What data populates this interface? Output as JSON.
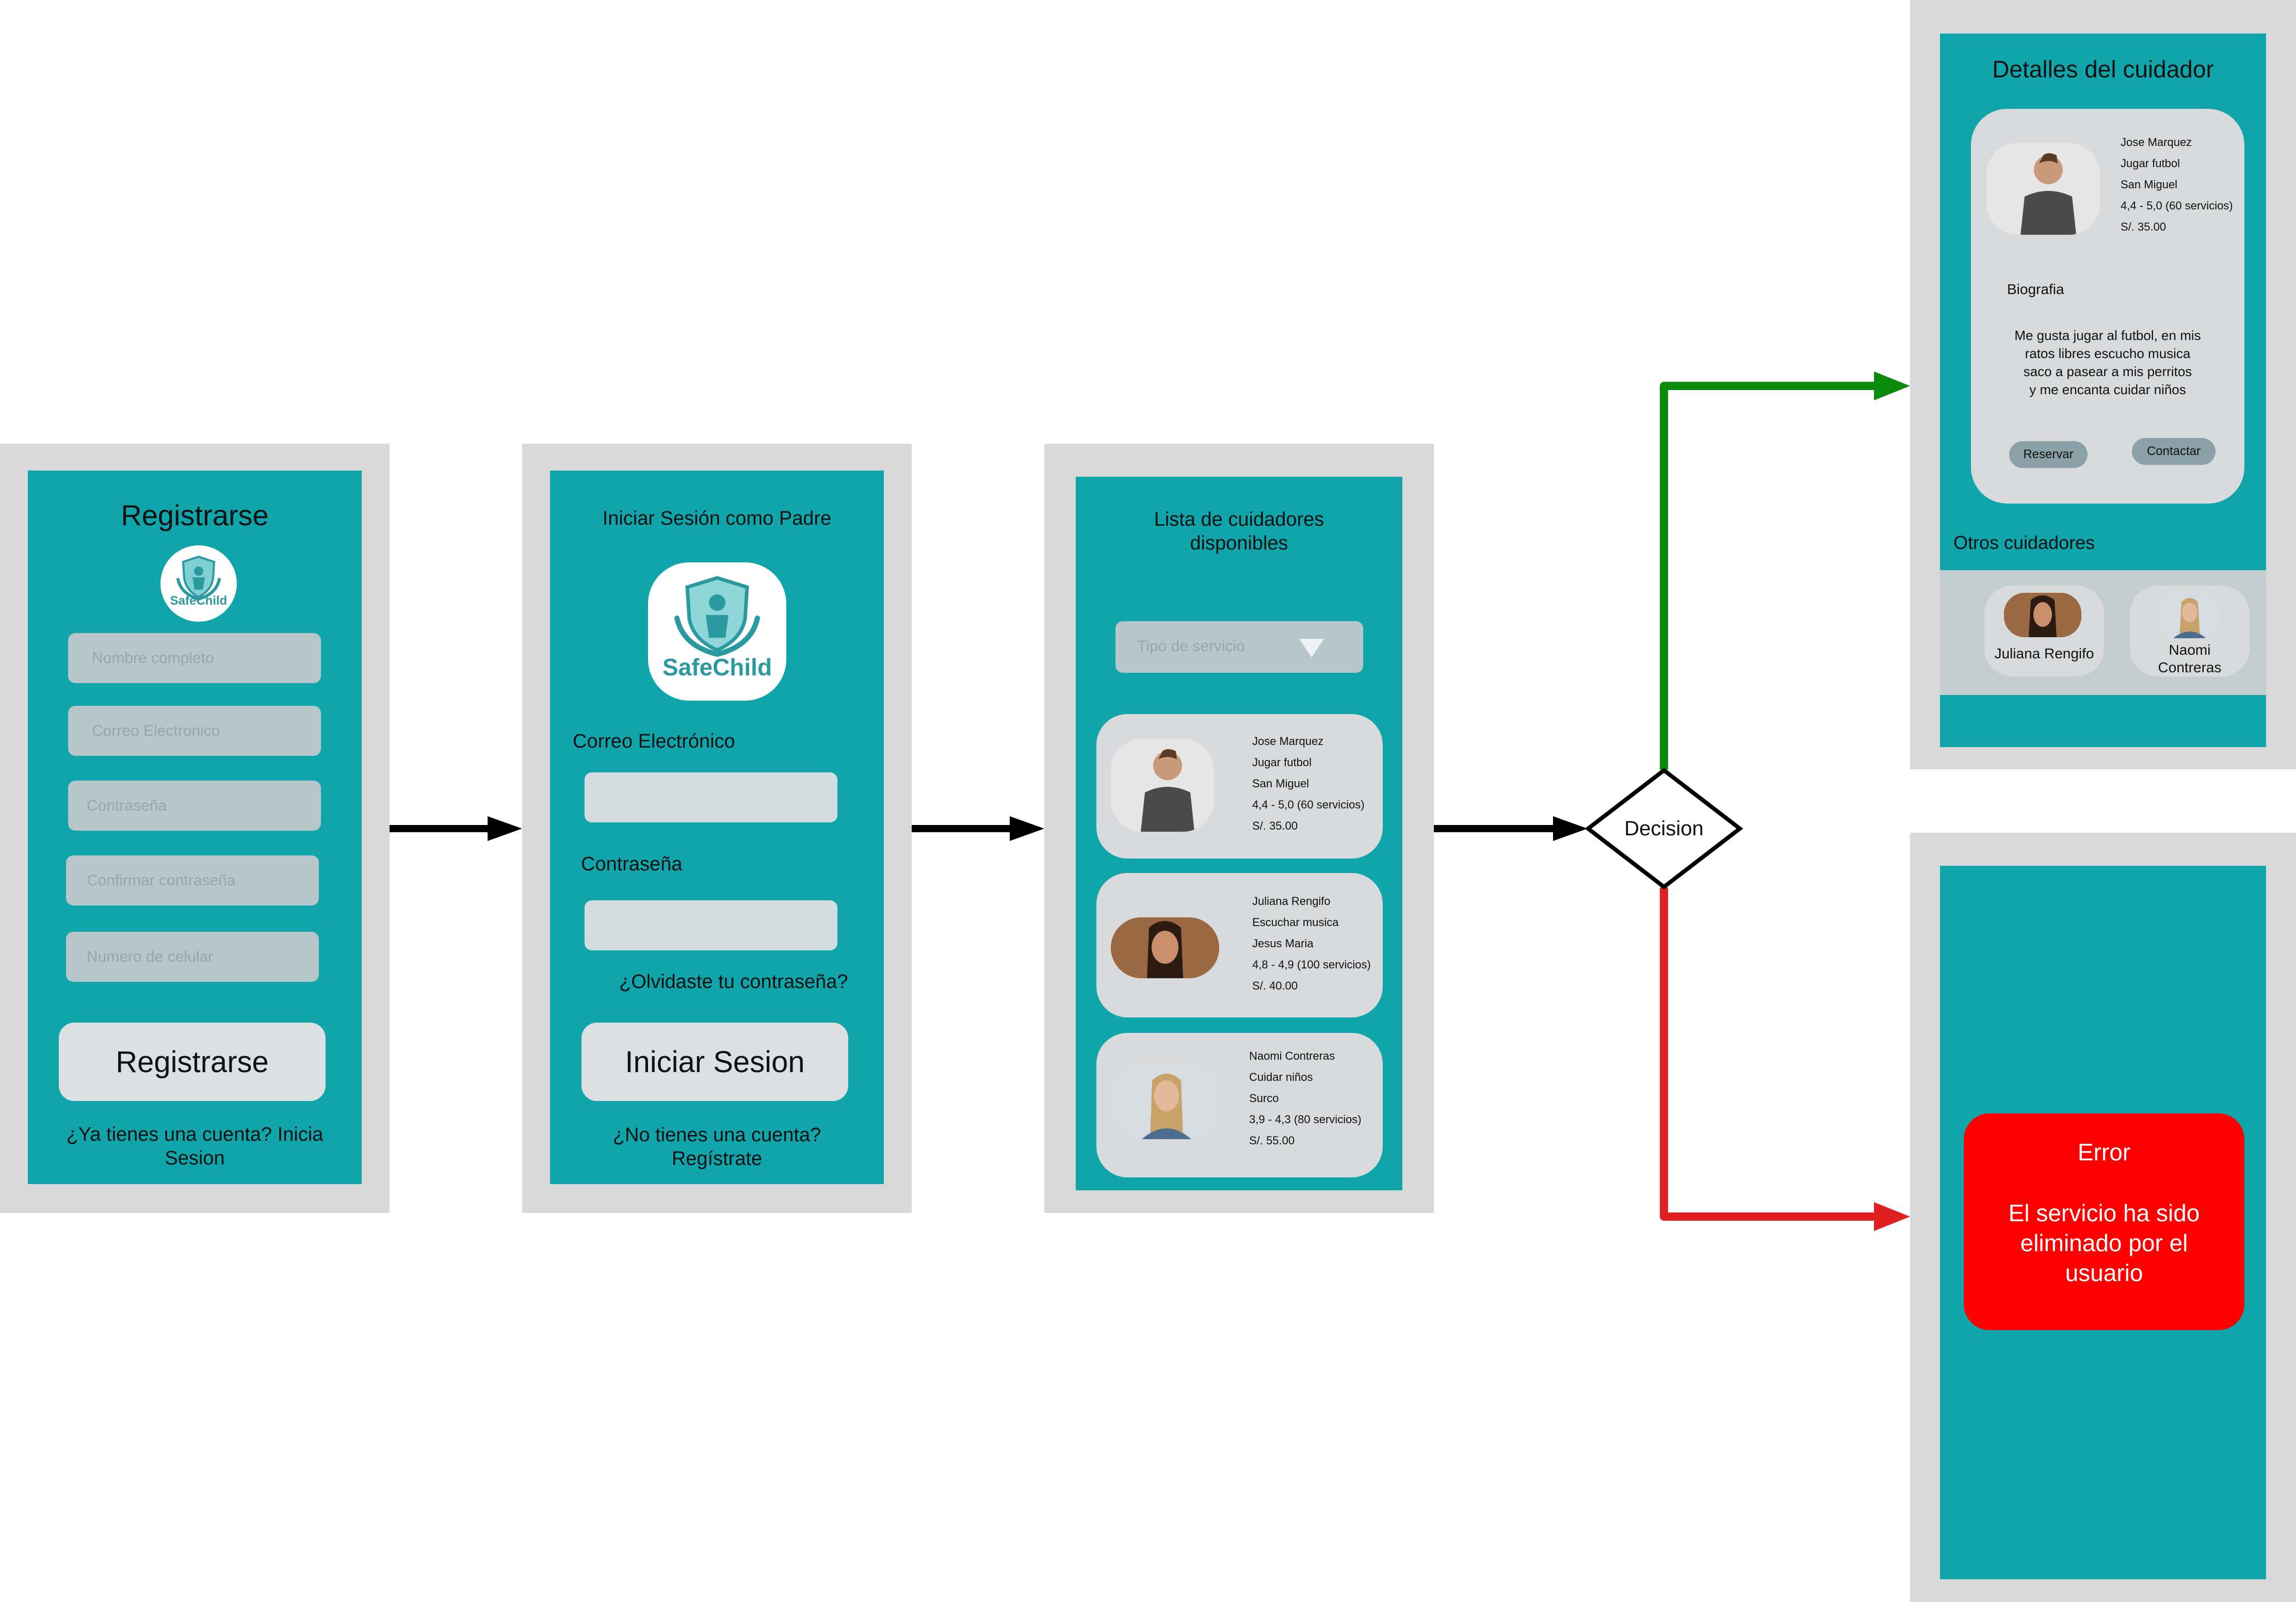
{
  "register": {
    "title": "Registrarse",
    "logo_text": "SafeChild",
    "fields": [
      "Nombre completo",
      "Correo Electronico",
      "Contraseña",
      "Confirmar contraseña",
      "Numero de celular"
    ],
    "button": "Registrarse",
    "footer_line1": "¿Ya tienes una cuenta? Inicia",
    "footer_line2": "Sesion"
  },
  "login": {
    "title": "Iniciar Sesión como Padre",
    "logo_text": "SafeChild",
    "email_label": "Correo Electrónico",
    "password_label": "Contraseña",
    "forgot": "¿Olvidaste tu contraseña?",
    "button": "Iniciar Sesion",
    "footer_line1": "¿No tienes una cuenta?",
    "footer_line2": "Regístrate"
  },
  "list": {
    "title_line1": "Lista de cuidadores",
    "title_line2": "disponibles",
    "dropdown_placeholder": "Tipo de servicio",
    "caregivers": [
      {
        "name": "Jose Marquez",
        "activity": "Jugar futbol",
        "district": "San Miguel",
        "rating": "4,4 - 5,0 (60 servicios)",
        "price": "S/. 35.00"
      },
      {
        "name": "Juliana Rengifo",
        "activity": "Escuchar musica",
        "district": "Jesus Maria",
        "rating": "4,8 - 4,9 (100 servicios)",
        "price": "S/. 40.00"
      },
      {
        "name": "Naomi Contreras",
        "activity": "Cuidar niños",
        "district": "Surco",
        "rating": "3,9 - 4,3 (80 servicios)",
        "price": "S/. 55.00"
      }
    ]
  },
  "decision": {
    "label": "Decision"
  },
  "details": {
    "title": "Detalles del cuidador",
    "name": "Jose Marquez",
    "activity": "Jugar futbol",
    "district": "San Miguel",
    "rating": "4,4 - 5,0 (60 servicios)",
    "price": "S/. 35.00",
    "bio_label": "Biografia",
    "bio_line1": "Me gusta jugar al futbol, en mis",
    "bio_line2": "ratos libres escucho musica",
    "bio_line3": "saco a pasear a mis perritos",
    "bio_line4": "y me encanta cuidar niños",
    "reserve_button": "Reservar",
    "contact_button": "Contactar",
    "others_label": "Otros cuidadores",
    "other1": "Juliana Rengifo",
    "other2_line1": "Naomi",
    "other2_line2": "Contreras"
  },
  "error": {
    "title": "Error",
    "message_line1": "El servicio ha sido",
    "message_line2": "eliminado por el",
    "message_line3": "usuario"
  },
  "colors": {
    "teal_screen": "#10a5aa",
    "frame_gray": "#d9d9d9",
    "success_arrow": "#0c8a0c",
    "error_arrow": "#e02020",
    "error_box": "#ff0000"
  }
}
